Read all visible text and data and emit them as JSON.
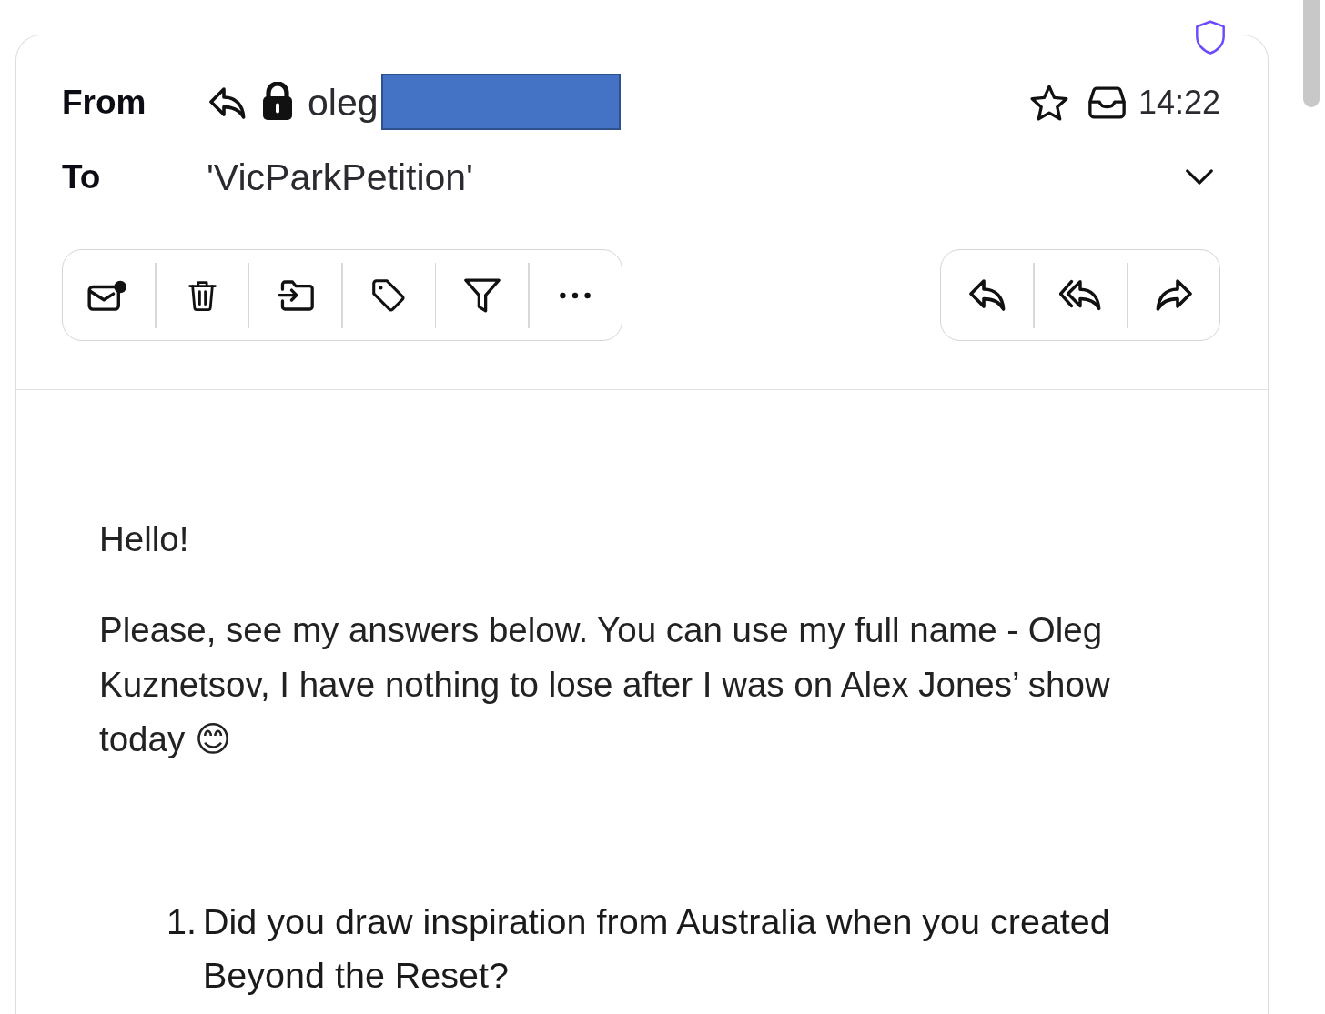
{
  "message_header": {
    "from": {
      "label": "From",
      "replied": true,
      "locked": true,
      "address": "oleg",
      "redacted": true
    },
    "to": {
      "label": "To",
      "recipient": "'VicParkPetition'"
    },
    "starred": false,
    "time": "14:22",
    "details_expanded": false
  },
  "body": {
    "greeting": "Hello!",
    "paragraph": "Please, see my answers below. You can use my full name - Oleg Kuznetsov, I have nothing to lose after I was on Alex Jones’ show today 😊",
    "questions": [
      {
        "number": "1.",
        "text": "Did you draw inspiration from Australia when you created Beyond the Reset?"
      }
    ]
  }
}
